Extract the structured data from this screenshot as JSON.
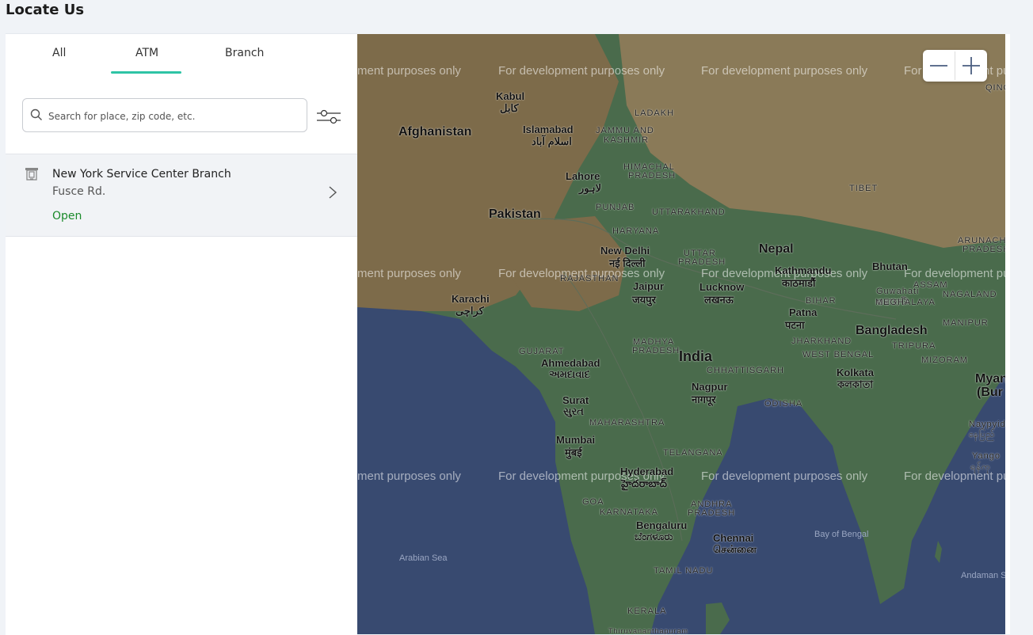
{
  "page": {
    "title": "Locate Us"
  },
  "tabs": [
    {
      "label": "All"
    },
    {
      "label": "ATM"
    },
    {
      "label": "Branch"
    }
  ],
  "active_tab": "ATM",
  "search": {
    "placeholder": "Search for place, zip code, etc.",
    "value": ""
  },
  "results": [
    {
      "name": "New York Service Center Branch",
      "address": "Fusce Rd.",
      "status": "Open"
    }
  ],
  "map": {
    "watermark": "For development purposes only",
    "watermark_partial_left": "ment purposes only",
    "watermark_partial_right": "For development pu",
    "countries": [
      "Afghanistan",
      "Pakistan",
      "India",
      "Nepal",
      "Bhutan",
      "Bangladesh",
      "TIBET"
    ],
    "country_partials": [
      "Myan",
      "(Bur"
    ],
    "cities": {
      "kabul": "Kabul",
      "kabul_native": "کابل",
      "islamabad": "Islamabad",
      "islamabad_native": "اسلام آباد",
      "lahore": "Lahore",
      "lahore_native": "لاہور",
      "new_delhi": "New Delhi",
      "new_delhi_native": "नई दिल्ली",
      "jaipur": "Jaipur",
      "jaipur_native": "जयपुर",
      "lucknow": "Lucknow",
      "lucknow_native": "लखनऊ",
      "kathmandu": "Kathmandu",
      "kathmandu_native": "काठमाडौं",
      "patna": "Patna",
      "patna_native": "पटना",
      "karachi": "Karachi",
      "karachi_native": "کراچی",
      "ahmedabad": "Ahmedabad",
      "ahmedabad_native": "અમદાવાદ",
      "surat": "Surat",
      "surat_native": "સુરત",
      "mumbai": "Mumbai",
      "mumbai_native": "मुंबई",
      "nagpur": "Nagpur",
      "nagpur_native": "नागपूर",
      "hyderabad": "Hyderabad",
      "hyderabad_native": "హైదరాబాద్",
      "bengaluru": "Bengaluru",
      "bengaluru_native": "ಬೆಂಗಳೂರು",
      "chennai": "Chennai",
      "chennai_native": "சென்னை",
      "kolkata": "Kolkata",
      "kolkata_native": "কলকাতা",
      "guwahati": "Guwahati",
      "guwahati_native": "গুৱাহাটী",
      "naypyidaw": "Naypyid",
      "naypyidaw_native": "နေပြည်",
      "yangon": "Yango",
      "yangon_native": "ရန်ကု",
      "thiruvananthapuram": "Thiruvananthapuram"
    },
    "regions": {
      "ladakh": "LADAKH",
      "jammu": "JAMMU AND",
      "kashmir": "KASHMIR",
      "himachal": "HIMACHAL",
      "pradesh_hp": "PRADESH",
      "punjab": "PUNJAB",
      "uttarakhand": "UTTARAKHAND",
      "haryana": "HARYANA",
      "uttar": "UTTAR",
      "pradesh_up": "PRADESH",
      "rajasthan": "RAJASTHAN",
      "bihar": "BIHAR",
      "arunachal": "ARUNACHAL",
      "pradesh_ar": "PRADESH",
      "assam": "ASSAM",
      "meghalaya": "MEGHALAYA",
      "nagaland": "NAGALAND",
      "manipur": "MANIPUR",
      "tripura": "TRIPURA",
      "mizoram": "MIZORAM",
      "jharkhand": "JHARKHAND",
      "west_bengal": "WEST BENGAL",
      "gujarat": "GUJARAT",
      "madhya": "MADHYA",
      "pradesh_mp": "PRADESH",
      "chhattisgarh": "CHHATTISGARH",
      "odisha": "ODISHA",
      "maharashtra": "MAHARASHTRA",
      "telangana": "TELANGANA",
      "goa": "GOA",
      "andhra": "ANDHRA",
      "pradesh_ap": "PRADESH",
      "karnataka": "KARNATAKA",
      "tamil_nadu": "TAMIL NADU",
      "kerala": "KERALA",
      "qinghai_partial": "QING"
    },
    "seas": {
      "arabian": "Arabian Sea",
      "bengal": "Bay of Bengal",
      "andaman": "Andaman S"
    }
  },
  "colors": {
    "accent": "#2ec4a5",
    "open_status": "#1a8a2a",
    "ocean": "#384a70",
    "land_green": "#4a6b4c",
    "land_brown": "#7d6b4a"
  }
}
